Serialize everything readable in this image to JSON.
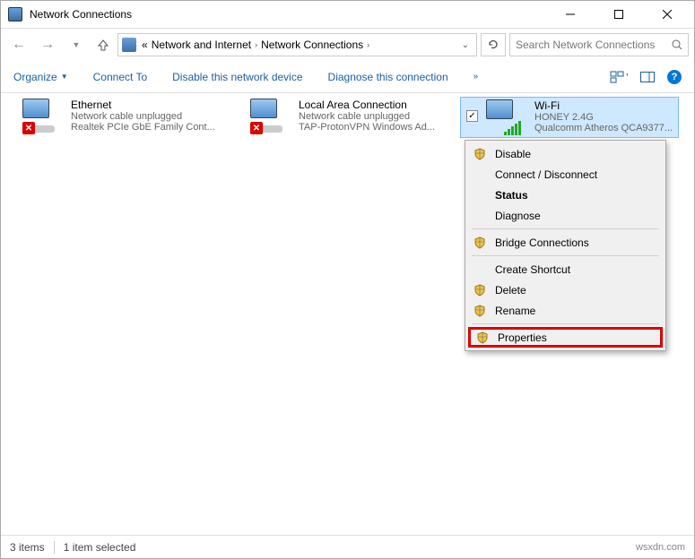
{
  "window": {
    "title": "Network Connections"
  },
  "breadcrumbs": {
    "prefix": "«",
    "seg1": "Network and Internet",
    "seg2": "Network Connections"
  },
  "search": {
    "placeholder": "Search Network Connections"
  },
  "cmdbar": {
    "organize": "Organize",
    "connect_to": "Connect To",
    "disable": "Disable this network device",
    "diagnose": "Diagnose this connection"
  },
  "adapters": [
    {
      "name": "Ethernet",
      "line2": "Network cable unplugged",
      "line3": "Realtek PCIe GbE Family Cont..."
    },
    {
      "name": "Local Area Connection",
      "line2": "Network cable unplugged",
      "line3": "TAP-ProtonVPN Windows Ad..."
    },
    {
      "name": "Wi-Fi",
      "line2": "HONEY 2.4G",
      "line3": "Qualcomm Atheros QCA9377..."
    }
  ],
  "menu": {
    "disable": "Disable",
    "connect": "Connect / Disconnect",
    "status": "Status",
    "diagnose": "Diagnose",
    "bridge": "Bridge Connections",
    "shortcut": "Create Shortcut",
    "delete": "Delete",
    "rename": "Rename",
    "properties": "Properties"
  },
  "status": {
    "items": "3 items",
    "selected": "1 item selected"
  },
  "watermark": "wsxdn.com"
}
